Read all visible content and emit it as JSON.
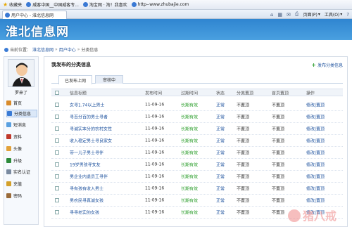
{
  "favorites_bar": {
    "favorites_label": "收藏夹",
    "items": [
      {
        "label": "威客中国__中国威客专..."
      },
      {
        "label": "淘宝网 · 淘！我喜欢"
      },
      {
        "label": "http--www.zhubajie.com"
      }
    ]
  },
  "tab": {
    "title": "用户中心 - 淮北信息网"
  },
  "toolbar": {
    "page_label": "页面(P)",
    "tools_label": "工具(O)"
  },
  "site": {
    "logo_text": "淮北信息网"
  },
  "breadcrumb": {
    "prefix": "当前位置：",
    "items": [
      "淮北信息网",
      "用户中心",
      "分类信息"
    ]
  },
  "sidebar": {
    "username": "罗来了",
    "items": [
      {
        "label": "首页"
      },
      {
        "label": "分类信息"
      },
      {
        "label": "短消息"
      },
      {
        "label": "资料"
      },
      {
        "label": "头像"
      },
      {
        "label": "升级"
      },
      {
        "label": "实名认证"
      },
      {
        "label": "充值"
      },
      {
        "label": "密码"
      }
    ]
  },
  "main": {
    "title": "我发布的分类信息",
    "publish_label": "发布分类信息",
    "tabs": [
      {
        "label": "已发布上网"
      },
      {
        "label": "审核中"
      }
    ],
    "columns": [
      "信息标题",
      "发布时间",
      "过期时间",
      "状态",
      "分类置顶",
      "首页置顶",
      "操作"
    ],
    "rows": [
      {
        "title": "女寻1.74以上男士",
        "date": "11-09-16",
        "expiry": "长期有效",
        "status": "正常",
        "cat_top": "不置顶",
        "home_top": "不置顶",
        "op_edit": "修改",
        "op_top": "置顶"
      },
      {
        "title": "寻百分百的男士寻者",
        "date": "11-09-16",
        "expiry": "长期有效",
        "status": "正常",
        "cat_top": "不置顶",
        "home_top": "不置顶",
        "op_edit": "修改",
        "op_top": "置顶"
      },
      {
        "title": "寻诚实本分的农村女性",
        "date": "11-09-16",
        "expiry": "长期有效",
        "status": "正常",
        "cat_top": "不置顶",
        "home_top": "不置顶",
        "op_edit": "修改",
        "op_top": "置顶"
      },
      {
        "title": "收入稳定男士寻良家女",
        "date": "11-09-16",
        "expiry": "长期有效",
        "status": "正常",
        "cat_top": "不置顶",
        "home_top": "不置顶",
        "op_edit": "修改",
        "op_top": "置顶"
      },
      {
        "title": "带一儿子男士寻伴",
        "date": "11-09-16",
        "expiry": "长期有效",
        "status": "正常",
        "cat_top": "不置顶",
        "home_top": "不置顶",
        "op_edit": "修改",
        "op_top": "置顶"
      },
      {
        "title": "19岁男孩寻女友",
        "date": "11-09-16",
        "expiry": "长期有效",
        "status": "正常",
        "cat_top": "不置顶",
        "home_top": "不置顶",
        "op_edit": "修改",
        "op_top": "置顶"
      },
      {
        "title": "男企业内退员工寻伴",
        "date": "11-09-16",
        "expiry": "长期有效",
        "status": "正常",
        "cat_top": "不置顶",
        "home_top": "不置顶",
        "op_edit": "修改",
        "op_top": "置顶"
      },
      {
        "title": "寻有孩有收入男士",
        "date": "11-09-16",
        "expiry": "长期有效",
        "status": "正常",
        "cat_top": "不置顶",
        "home_top": "不置顶",
        "op_edit": "修改",
        "op_top": "置顶"
      },
      {
        "title": "男农民寻真诚女孩",
        "date": "11-09-16",
        "expiry": "长期有效",
        "status": "正常",
        "cat_top": "不置顶",
        "home_top": "不置顶",
        "op_edit": "修改",
        "op_top": "置顶"
      },
      {
        "title": "寻寻老实的女孩",
        "date": "11-09-16",
        "expiry": "长期有效",
        "status": "正常",
        "cat_top": "不置顶",
        "home_top": "不置顶",
        "op_edit": "修改",
        "op_top": "置顶"
      }
    ],
    "op_separator": "|"
  },
  "watermark": {
    "text": "猪八戒"
  }
}
